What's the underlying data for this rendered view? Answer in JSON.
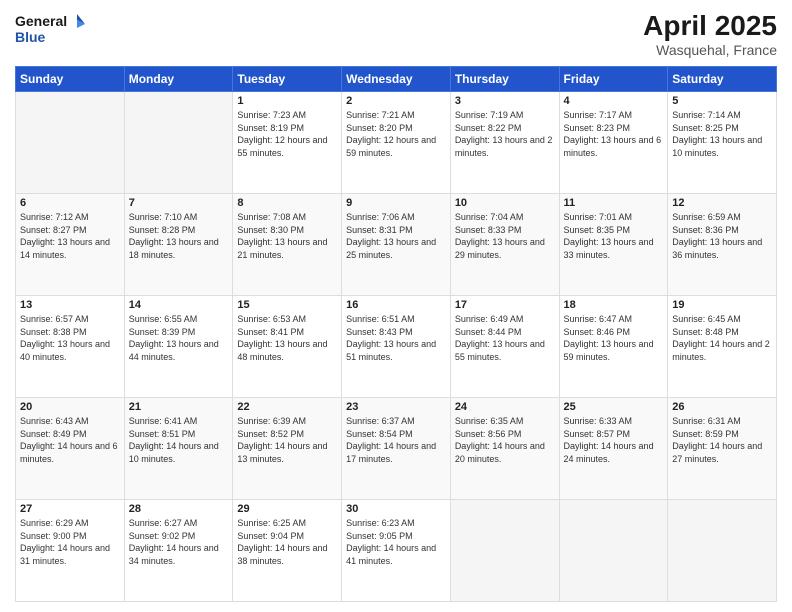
{
  "header": {
    "logo_line1": "General",
    "logo_line2": "Blue",
    "title": "April 2025",
    "location": "Wasquehal, France"
  },
  "days_of_week": [
    "Sunday",
    "Monday",
    "Tuesday",
    "Wednesday",
    "Thursday",
    "Friday",
    "Saturday"
  ],
  "weeks": [
    [
      {
        "day": "",
        "info": ""
      },
      {
        "day": "",
        "info": ""
      },
      {
        "day": "1",
        "info": "Sunrise: 7:23 AM\nSunset: 8:19 PM\nDaylight: 12 hours and 55 minutes."
      },
      {
        "day": "2",
        "info": "Sunrise: 7:21 AM\nSunset: 8:20 PM\nDaylight: 12 hours and 59 minutes."
      },
      {
        "day": "3",
        "info": "Sunrise: 7:19 AM\nSunset: 8:22 PM\nDaylight: 13 hours and 2 minutes."
      },
      {
        "day": "4",
        "info": "Sunrise: 7:17 AM\nSunset: 8:23 PM\nDaylight: 13 hours and 6 minutes."
      },
      {
        "day": "5",
        "info": "Sunrise: 7:14 AM\nSunset: 8:25 PM\nDaylight: 13 hours and 10 minutes."
      }
    ],
    [
      {
        "day": "6",
        "info": "Sunrise: 7:12 AM\nSunset: 8:27 PM\nDaylight: 13 hours and 14 minutes."
      },
      {
        "day": "7",
        "info": "Sunrise: 7:10 AM\nSunset: 8:28 PM\nDaylight: 13 hours and 18 minutes."
      },
      {
        "day": "8",
        "info": "Sunrise: 7:08 AM\nSunset: 8:30 PM\nDaylight: 13 hours and 21 minutes."
      },
      {
        "day": "9",
        "info": "Sunrise: 7:06 AM\nSunset: 8:31 PM\nDaylight: 13 hours and 25 minutes."
      },
      {
        "day": "10",
        "info": "Sunrise: 7:04 AM\nSunset: 8:33 PM\nDaylight: 13 hours and 29 minutes."
      },
      {
        "day": "11",
        "info": "Sunrise: 7:01 AM\nSunset: 8:35 PM\nDaylight: 13 hours and 33 minutes."
      },
      {
        "day": "12",
        "info": "Sunrise: 6:59 AM\nSunset: 8:36 PM\nDaylight: 13 hours and 36 minutes."
      }
    ],
    [
      {
        "day": "13",
        "info": "Sunrise: 6:57 AM\nSunset: 8:38 PM\nDaylight: 13 hours and 40 minutes."
      },
      {
        "day": "14",
        "info": "Sunrise: 6:55 AM\nSunset: 8:39 PM\nDaylight: 13 hours and 44 minutes."
      },
      {
        "day": "15",
        "info": "Sunrise: 6:53 AM\nSunset: 8:41 PM\nDaylight: 13 hours and 48 minutes."
      },
      {
        "day": "16",
        "info": "Sunrise: 6:51 AM\nSunset: 8:43 PM\nDaylight: 13 hours and 51 minutes."
      },
      {
        "day": "17",
        "info": "Sunrise: 6:49 AM\nSunset: 8:44 PM\nDaylight: 13 hours and 55 minutes."
      },
      {
        "day": "18",
        "info": "Sunrise: 6:47 AM\nSunset: 8:46 PM\nDaylight: 13 hours and 59 minutes."
      },
      {
        "day": "19",
        "info": "Sunrise: 6:45 AM\nSunset: 8:48 PM\nDaylight: 14 hours and 2 minutes."
      }
    ],
    [
      {
        "day": "20",
        "info": "Sunrise: 6:43 AM\nSunset: 8:49 PM\nDaylight: 14 hours and 6 minutes."
      },
      {
        "day": "21",
        "info": "Sunrise: 6:41 AM\nSunset: 8:51 PM\nDaylight: 14 hours and 10 minutes."
      },
      {
        "day": "22",
        "info": "Sunrise: 6:39 AM\nSunset: 8:52 PM\nDaylight: 14 hours and 13 minutes."
      },
      {
        "day": "23",
        "info": "Sunrise: 6:37 AM\nSunset: 8:54 PM\nDaylight: 14 hours and 17 minutes."
      },
      {
        "day": "24",
        "info": "Sunrise: 6:35 AM\nSunset: 8:56 PM\nDaylight: 14 hours and 20 minutes."
      },
      {
        "day": "25",
        "info": "Sunrise: 6:33 AM\nSunset: 8:57 PM\nDaylight: 14 hours and 24 minutes."
      },
      {
        "day": "26",
        "info": "Sunrise: 6:31 AM\nSunset: 8:59 PM\nDaylight: 14 hours and 27 minutes."
      }
    ],
    [
      {
        "day": "27",
        "info": "Sunrise: 6:29 AM\nSunset: 9:00 PM\nDaylight: 14 hours and 31 minutes."
      },
      {
        "day": "28",
        "info": "Sunrise: 6:27 AM\nSunset: 9:02 PM\nDaylight: 14 hours and 34 minutes."
      },
      {
        "day": "29",
        "info": "Sunrise: 6:25 AM\nSunset: 9:04 PM\nDaylight: 14 hours and 38 minutes."
      },
      {
        "day": "30",
        "info": "Sunrise: 6:23 AM\nSunset: 9:05 PM\nDaylight: 14 hours and 41 minutes."
      },
      {
        "day": "",
        "info": ""
      },
      {
        "day": "",
        "info": ""
      },
      {
        "day": "",
        "info": ""
      }
    ]
  ]
}
